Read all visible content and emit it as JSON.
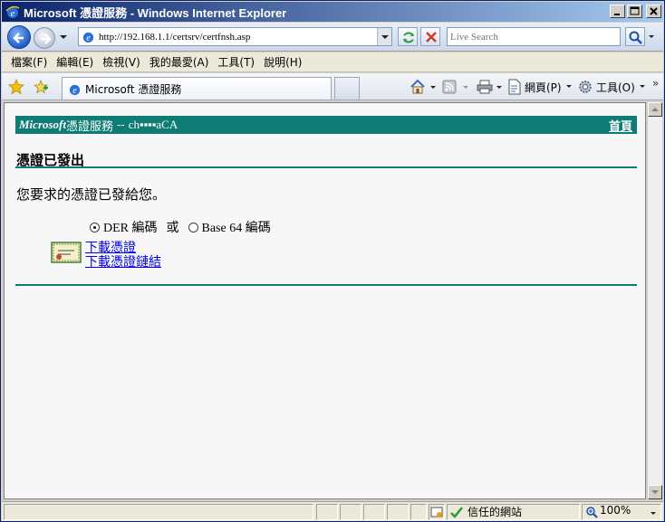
{
  "window": {
    "title": "Microsoft 憑證服務 - Windows Internet Explorer"
  },
  "address_bar": {
    "url": "http://192.168.1.1/certsrv/certfnsh.asp",
    "search_placeholder": "Live Search"
  },
  "menu": {
    "items": [
      "檔案(F)",
      "編輯(E)",
      "檢視(V)",
      "我的最愛(A)",
      "工具(T)",
      "說明(H)"
    ]
  },
  "tab": {
    "label": "Microsoft 憑證服務"
  },
  "command_bar": {
    "page_label": "網頁(P)",
    "tools_label": "工具(O)",
    "chevron": "»"
  },
  "page": {
    "banner": {
      "ms": "Microsoft",
      "service": "憑證服務",
      "separator": "--",
      "ca_name": "ch▪▪▪▪aCA",
      "home_link": "首頁"
    },
    "heading": "憑證已發出",
    "message": "您要求的憑證已發給您。",
    "encoding": {
      "der_label": "DER 編碼",
      "or_label": "或",
      "base64_label": "Base 64 編碼",
      "selected": "DER"
    },
    "links": {
      "download_cert": "下載憑證",
      "download_chain": "下載憑證鏈結"
    }
  },
  "status_bar": {
    "zone": "信任的網站",
    "zoom": "100%"
  },
  "colors": {
    "banner_bg": "#0e7c74",
    "link": "#0000ee",
    "title_gradient_start": "#0a246a",
    "title_gradient_end": "#a6caf0"
  }
}
